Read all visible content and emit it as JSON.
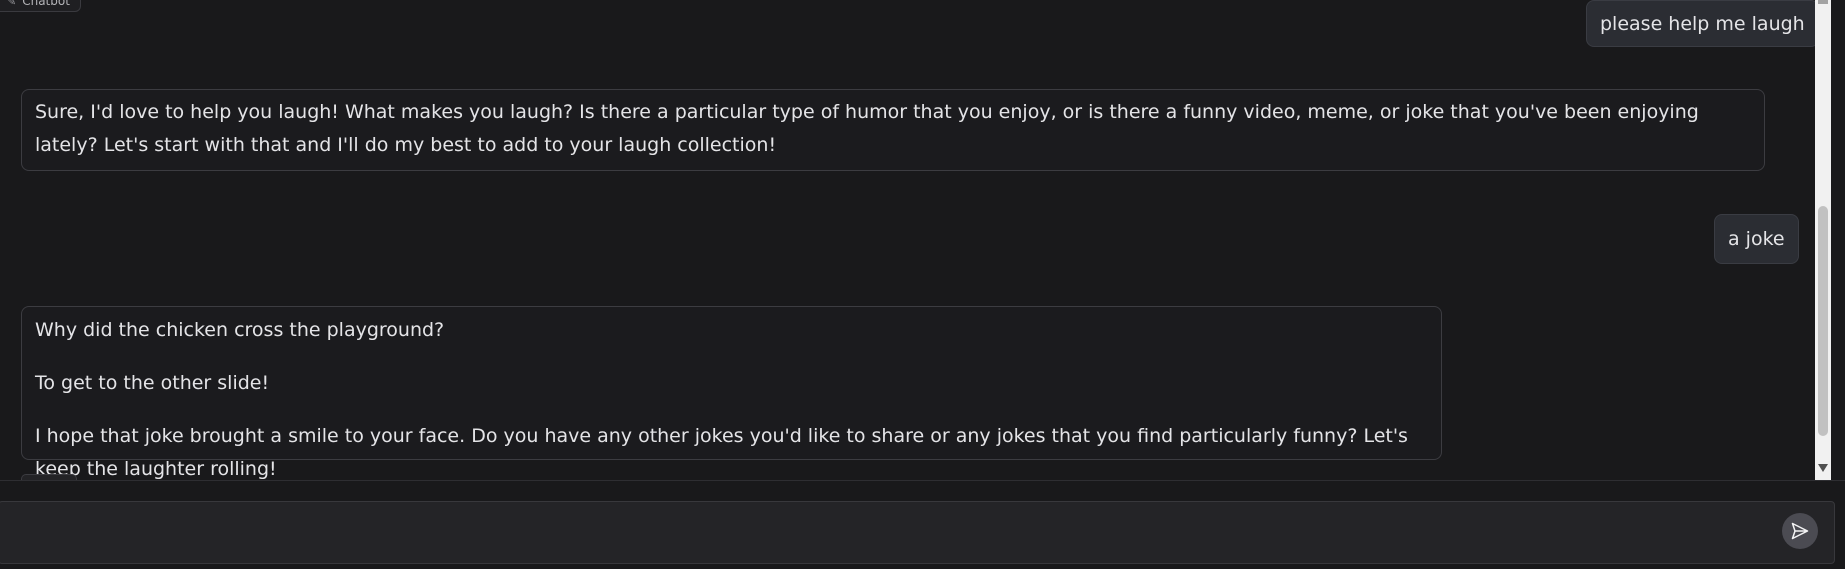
{
  "chatbot": {
    "label": "Chatbot"
  },
  "messages": [
    {
      "role": "user",
      "text": "please help me laugh"
    },
    {
      "role": "bot",
      "paragraphs": [
        "Sure, I'd love to help you laugh! What makes you laugh? Is there a particular type of humor that you enjoy, or is there a funny video, meme, or joke that you've been enjoying lately? Let's start with that and I'll do my best to add to your laugh collection!"
      ]
    },
    {
      "role": "user",
      "text": "a joke"
    },
    {
      "role": "bot",
      "paragraphs": [
        "Why did the chicken cross the playground?",
        "To get to the other slide!",
        "I hope that joke brought a smile to your face. Do you have any other jokes you'd like to share or any jokes that you find particularly funny? Let's keep the laughter rolling!"
      ]
    }
  ],
  "input": {
    "value": "",
    "placeholder": ""
  },
  "icons": {
    "chatbot_label_icon": "chat-icon",
    "send": "send-icon"
  },
  "colors": {
    "background": "#19191b",
    "user_bubble": "#2b2d33",
    "bot_bubble_border": "#3c3c41",
    "send_button": "#4b4b52"
  }
}
